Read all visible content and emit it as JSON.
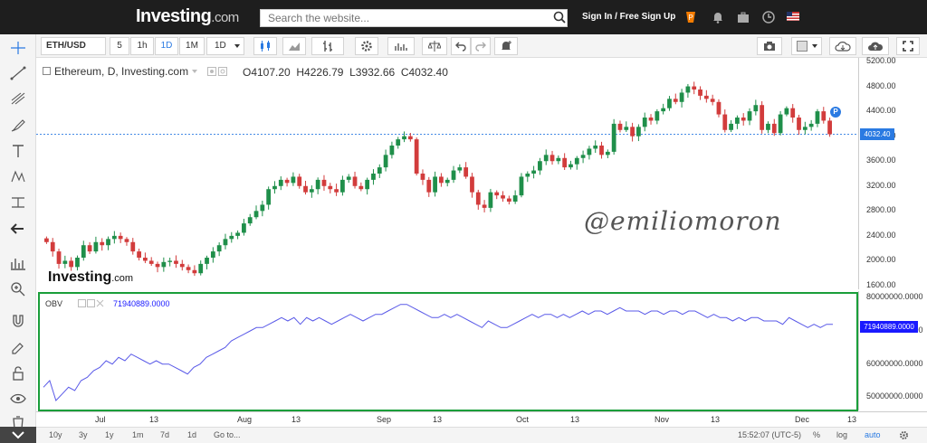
{
  "topbar": {
    "logo_main": "Investing",
    "logo_suffix": ".com",
    "search_placeholder": "Search the website...",
    "signin": "Sign In / Free Sign Up"
  },
  "toolbar": {
    "symbol": "ETH/USD",
    "intervals": [
      "5",
      "1h",
      "1D",
      "1M",
      "1D"
    ],
    "active_interval_index": 2
  },
  "chart": {
    "title": "Ethereum, D, Investing.com",
    "ohlc": {
      "o": "O4107.20",
      "h": "H4226.79",
      "l": "L3932.66",
      "c": "C4032.40"
    },
    "price_tag": "4032.40",
    "p_marker": "P",
    "watermark": "@emiliomoron",
    "logo_main": "Investing",
    "logo_suffix": ".com",
    "colors": {
      "up": "#1f8f4a",
      "down": "#d23c3c",
      "obv_line": "#5a5ae8",
      "highlight": "#1a9e3a"
    }
  },
  "obv": {
    "label": "OBV",
    "value": "71940889.0000",
    "value_tag": "71940889.0000"
  },
  "price_axis_labels": [
    "5200.00",
    "4800.00",
    "4400.00",
    "4000.00",
    "3600.00",
    "3200.00",
    "2800.00",
    "2400.00",
    "2000.00",
    "1600.00"
  ],
  "obv_axis_labels": [
    "80000000.0000",
    "70000000.0000",
    "60000000.0000",
    "50000000.0000"
  ],
  "x_axis_labels": [
    "Jul",
    "13",
    "Aug",
    "13",
    "Sep",
    "13",
    "Oct",
    "13",
    "Nov",
    "13",
    "Dec",
    "13"
  ],
  "bottombar": {
    "ranges": [
      "10y",
      "3y",
      "1y",
      "1m",
      "7d",
      "1d",
      "Go to..."
    ],
    "time": "15:52:07 (UTC-5)",
    "percent": "%",
    "log": "log",
    "auto": "auto"
  },
  "chart_data": [
    {
      "type": "candlestick",
      "title": "Ethereum, D, Investing.com",
      "ylim": [
        1600,
        5200
      ],
      "close": [
        2300,
        2150,
        1950,
        2000,
        1900,
        2050,
        2250,
        2150,
        2300,
        2250,
        2350,
        2400,
        2350,
        2300,
        2150,
        2050,
        2000,
        1950,
        1900,
        1980,
        2000,
        1950,
        1900,
        1850,
        1800,
        1950,
        2050,
        2150,
        2250,
        2350,
        2400,
        2450,
        2600,
        2700,
        2800,
        2900,
        3150,
        3200,
        3300,
        3250,
        3350,
        3200,
        3100,
        3150,
        3300,
        3200,
        3150,
        3100,
        3300,
        3350,
        3200,
        3150,
        3300,
        3400,
        3500,
        3700,
        3850,
        3950,
        4000,
        3950,
        3400,
        3300,
        3100,
        3350,
        3250,
        3300,
        3450,
        3500,
        3350,
        3100,
        2900,
        2850,
        3100,
        3050,
        3000,
        2950,
        3050,
        3350,
        3400,
        3450,
        3600,
        3700,
        3600,
        3650,
        3500,
        3550,
        3650,
        3700,
        3800,
        3850,
        3700,
        3750,
        4200,
        4100,
        4150,
        4000,
        4150,
        4300,
        4250,
        4400,
        4450,
        4600,
        4550,
        4700,
        4800,
        4750,
        4650,
        4600,
        4550,
        4350,
        4100,
        4200,
        4300,
        4250,
        4400,
        4500,
        4100,
        4200,
        4050,
        4350,
        4450,
        4300,
        4100,
        4150,
        4200,
        4400,
        4250,
        4032
      ],
      "current": 4032.4
    },
    {
      "type": "line",
      "ylim": [
        46000000,
        82000000
      ],
      "values": [
        53,
        55,
        49,
        51,
        53,
        52,
        55,
        56,
        58,
        59,
        61,
        60,
        62,
        61,
        63,
        62,
        61,
        60,
        61,
        60,
        60,
        59,
        58,
        57,
        59,
        60,
        62,
        63,
        64,
        65,
        67,
        68,
        69,
        70,
        71,
        71,
        72,
        73,
        74,
        73,
        74,
        72,
        74,
        73,
        74,
        73,
        72,
        73,
        74,
        75,
        74,
        73,
        74,
        75,
        75,
        76,
        77,
        78,
        78,
        77,
        76,
        75,
        74,
        74,
        75,
        74,
        75,
        74,
        73,
        72,
        71,
        73,
        72,
        71,
        71,
        72,
        73,
        74,
        75,
        74,
        75,
        75,
        74,
        75,
        74,
        75,
        76,
        75,
        76,
        76,
        75,
        76,
        77,
        76,
        76,
        76,
        75,
        76,
        76,
        75,
        76,
        76,
        75,
        76,
        76,
        75,
        74,
        75,
        74,
        74,
        73,
        74,
        73,
        74,
        74,
        73,
        73,
        73,
        72,
        74,
        73,
        72,
        71,
        72,
        71,
        72,
        72
      ]
    }
  ]
}
